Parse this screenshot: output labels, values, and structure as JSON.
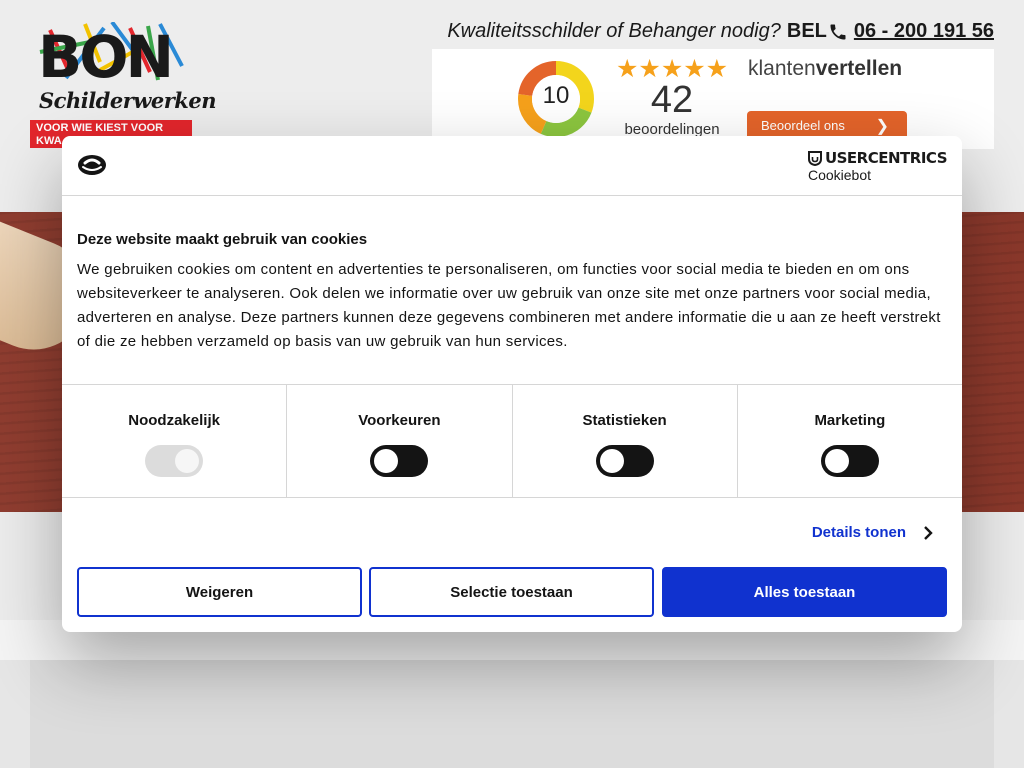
{
  "site": {
    "logo": {
      "word": "BON",
      "script": "Schilderwerken",
      "band_line1": "VOOR WIE KIEST VOOR",
      "band_line2": "KWA"
    },
    "call": {
      "question": "Kwaliteitsschilder of Behanger nodig?",
      "bel": "BEL",
      "phone": "06 - 200 191 56"
    },
    "reviews": {
      "score": "10",
      "stars": "★★★★★",
      "count": "42",
      "count_label": "beoordelingen",
      "brand_light": "klanten",
      "brand_bold": "vertellen",
      "rate_button": "Beoordeel ons"
    }
  },
  "cookie_dialog": {
    "provider_name": "USERCENTRICS",
    "provider_sub": "Cookiebot",
    "title": "Deze website maakt gebruik van cookies",
    "body": "We gebruiken cookies om content en advertenties te personaliseren, om functies voor social media te bieden en om ons websiteverkeer te analyseren. Ook delen we informatie over uw gebruik van onze site met onze partners voor social media, adverteren en analyse. Deze partners kunnen deze gegevens combineren met andere informatie die u aan ze heeft verstrekt of die ze hebben verzameld op basis van uw gebruik van hun services.",
    "categories": [
      {
        "label": "Noodzakelijk",
        "enabled": true,
        "locked": true
      },
      {
        "label": "Voorkeuren",
        "enabled": false,
        "locked": false
      },
      {
        "label": "Statistieken",
        "enabled": false,
        "locked": false
      },
      {
        "label": "Marketing",
        "enabled": false,
        "locked": false
      }
    ],
    "details_link": "Details tonen",
    "buttons": {
      "deny": "Weigeren",
      "allow_selection": "Selectie toestaan",
      "allow_all": "Alles toestaan"
    },
    "accent_color": "#1032cf"
  },
  "colors": {
    "logo_red": "#e3262c",
    "review_orange": "#e4642a",
    "star_color": "#f6a11b",
    "hero_wood": "#8f3d30"
  }
}
